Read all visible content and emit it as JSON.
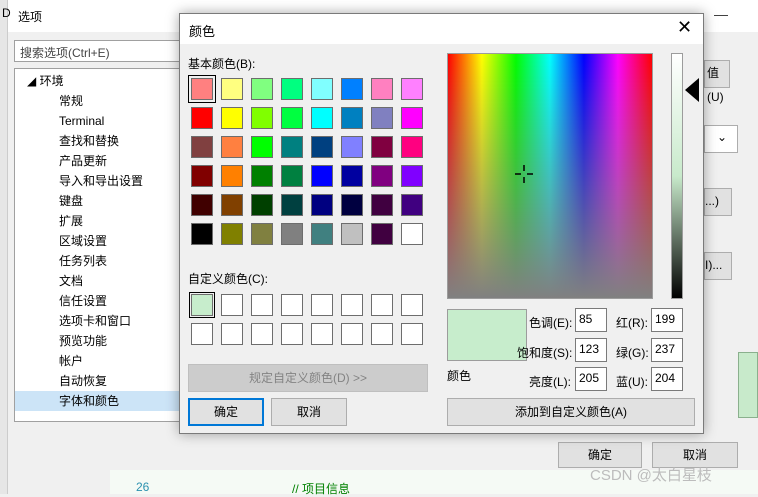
{
  "options_window": {
    "title": "选项",
    "left_label": "D",
    "search_placeholder": "搜索选项(Ctrl+E)",
    "tree": [
      {
        "label": "◢  环境",
        "level": 0
      },
      {
        "label": "常规",
        "level": 1
      },
      {
        "label": "Terminal",
        "level": 1
      },
      {
        "label": "查找和替换",
        "level": 1
      },
      {
        "label": "产品更新",
        "level": 1
      },
      {
        "label": "导入和导出设置",
        "level": 1
      },
      {
        "label": "键盘",
        "level": 1
      },
      {
        "label": "扩展",
        "level": 1
      },
      {
        "label": "区域设置",
        "level": 1
      },
      {
        "label": "任务列表",
        "level": 1
      },
      {
        "label": "文档",
        "level": 1
      },
      {
        "label": "信任设置",
        "level": 1
      },
      {
        "label": "选项卡和窗口",
        "level": 1
      },
      {
        "label": "预览功能",
        "level": 1
      },
      {
        "label": "帐户",
        "level": 1
      },
      {
        "label": "自动恢复",
        "level": 1
      },
      {
        "label": "字体和颜色",
        "level": 1,
        "selected": true
      }
    ],
    "side_button_1": "值(U)",
    "side_button_2": "...)",
    "side_button_3": "I)...",
    "ok": "确定",
    "cancel": "取消",
    "editor_line_number": "26",
    "editor_code": "//  项目信息",
    "watermark": "CSDN @太白星枝"
  },
  "color_dialog": {
    "title": "颜色",
    "close_glyph": "✕",
    "basic_colors_label": "基本颜色(B):",
    "basic_colors": [
      "#ff8080",
      "#ffff80",
      "#80ff80",
      "#00ff80",
      "#80ffff",
      "#0080ff",
      "#ff80c0",
      "#ff80ff",
      "#ff0000",
      "#ffff00",
      "#80ff00",
      "#00ff40",
      "#00ffff",
      "#0080c0",
      "#8080c0",
      "#ff00ff",
      "#804040",
      "#ff8040",
      "#00ff00",
      "#008080",
      "#004080",
      "#8080ff",
      "#800040",
      "#ff0080",
      "#800000",
      "#ff8000",
      "#008000",
      "#008040",
      "#0000ff",
      "#0000a0",
      "#800080",
      "#8000ff",
      "#400000",
      "#804000",
      "#004000",
      "#004040",
      "#000080",
      "#000040",
      "#400040",
      "#400080",
      "#000000",
      "#808000",
      "#808040",
      "#808080",
      "#408080",
      "#c0c0c0",
      "#400040",
      "#ffffff"
    ],
    "custom_colors_label": "自定义颜色(C):",
    "custom_colors": [
      "#c7edcc",
      "#ffffff",
      "#ffffff",
      "#ffffff",
      "#ffffff",
      "#ffffff",
      "#ffffff",
      "#ffffff",
      "#ffffff",
      "#ffffff",
      "#ffffff",
      "#ffffff",
      "#ffffff",
      "#ffffff",
      "#ffffff",
      "#ffffff"
    ],
    "define_custom_button": "规定自定义颜色(D) >>",
    "ok_button": "确定",
    "cancel_button": "取消",
    "add_custom_button": "添加到自定义颜色(A)",
    "preview_label": "颜色",
    "preview_color": "#c7edcc",
    "fields": {
      "hue_label": "色调(E):",
      "hue": "85",
      "sat_label": "饱和度(S):",
      "sat": "123",
      "lum_label": "亮度(L):",
      "lum": "205",
      "red_label": "红(R):",
      "red": "199",
      "green_label": "绿(G):",
      "green": "237",
      "blue_label": "蓝(U):",
      "blue": "204"
    }
  }
}
